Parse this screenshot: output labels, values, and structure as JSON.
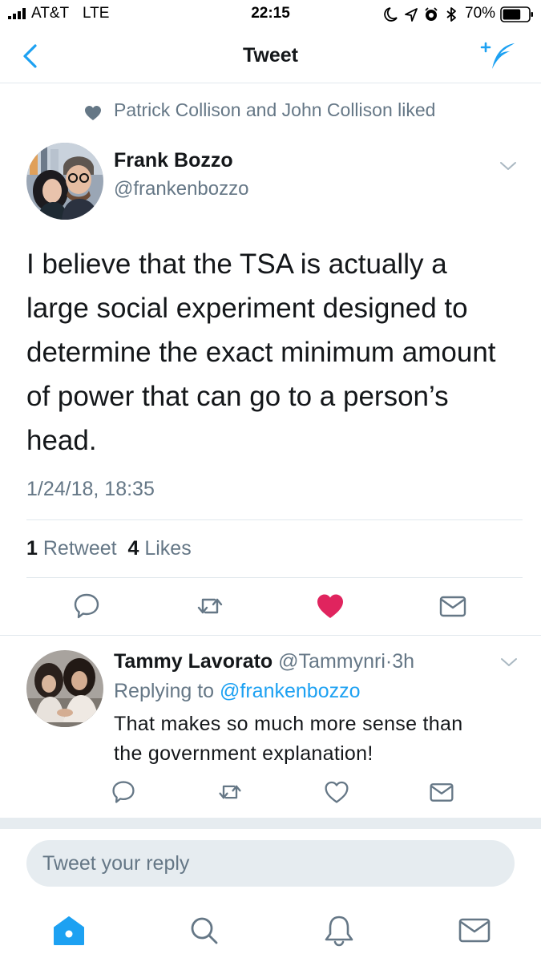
{
  "status_bar": {
    "carrier": "AT&T",
    "network": "LTE",
    "time": "22:15",
    "battery": "70%",
    "battery_level": 0.7,
    "icons": [
      "signal-icon",
      "moon-icon",
      "location-icon",
      "alarm-icon",
      "bluetooth-icon",
      "battery-icon"
    ]
  },
  "nav": {
    "title": "Tweet",
    "back_icon": "chevron-left-icon",
    "compose_icon": "compose-tweet-icon"
  },
  "social_context": {
    "icon": "heart-icon",
    "text": "Patrick Collison and John Collison liked"
  },
  "tweet": {
    "author_name": "Frank Bozzo",
    "author_handle": "@frankenbozzo",
    "text_lines": [
      "I believe that the TSA is actually a",
      "large social experiment designed to",
      "determine the exact minimum amount",
      "of power that can go to a person’s",
      "head."
    ],
    "timestamp": "1/24/18, 18:35",
    "retweet_count": "1",
    "retweet_label": "Retweet",
    "like_count": "4",
    "like_label": "Likes",
    "actions": [
      "reply-icon",
      "retweet-icon",
      "like-icon",
      "direct-message-icon"
    ]
  },
  "reply": {
    "author_name": "Tammy Lavorato",
    "author_handle": "@Tammynri",
    "separator": "·",
    "age": "3h",
    "replying_to_label": "Replying to",
    "replying_to_handle": "@frankenbozzo",
    "text_lines": [
      "That makes so much more sense than",
      "the government explanation!"
    ]
  },
  "composer": {
    "placeholder": "Tweet your reply"
  },
  "tab_bar": {
    "tabs": [
      "home-icon",
      "search-icon",
      "notifications-icon",
      "messages-icon"
    ]
  },
  "colors": {
    "accent": "#1da1f2",
    "like": "#e0245e",
    "muted_text": "#657786",
    "divider": "#e1e8ed",
    "band": "#e6ecf0"
  }
}
